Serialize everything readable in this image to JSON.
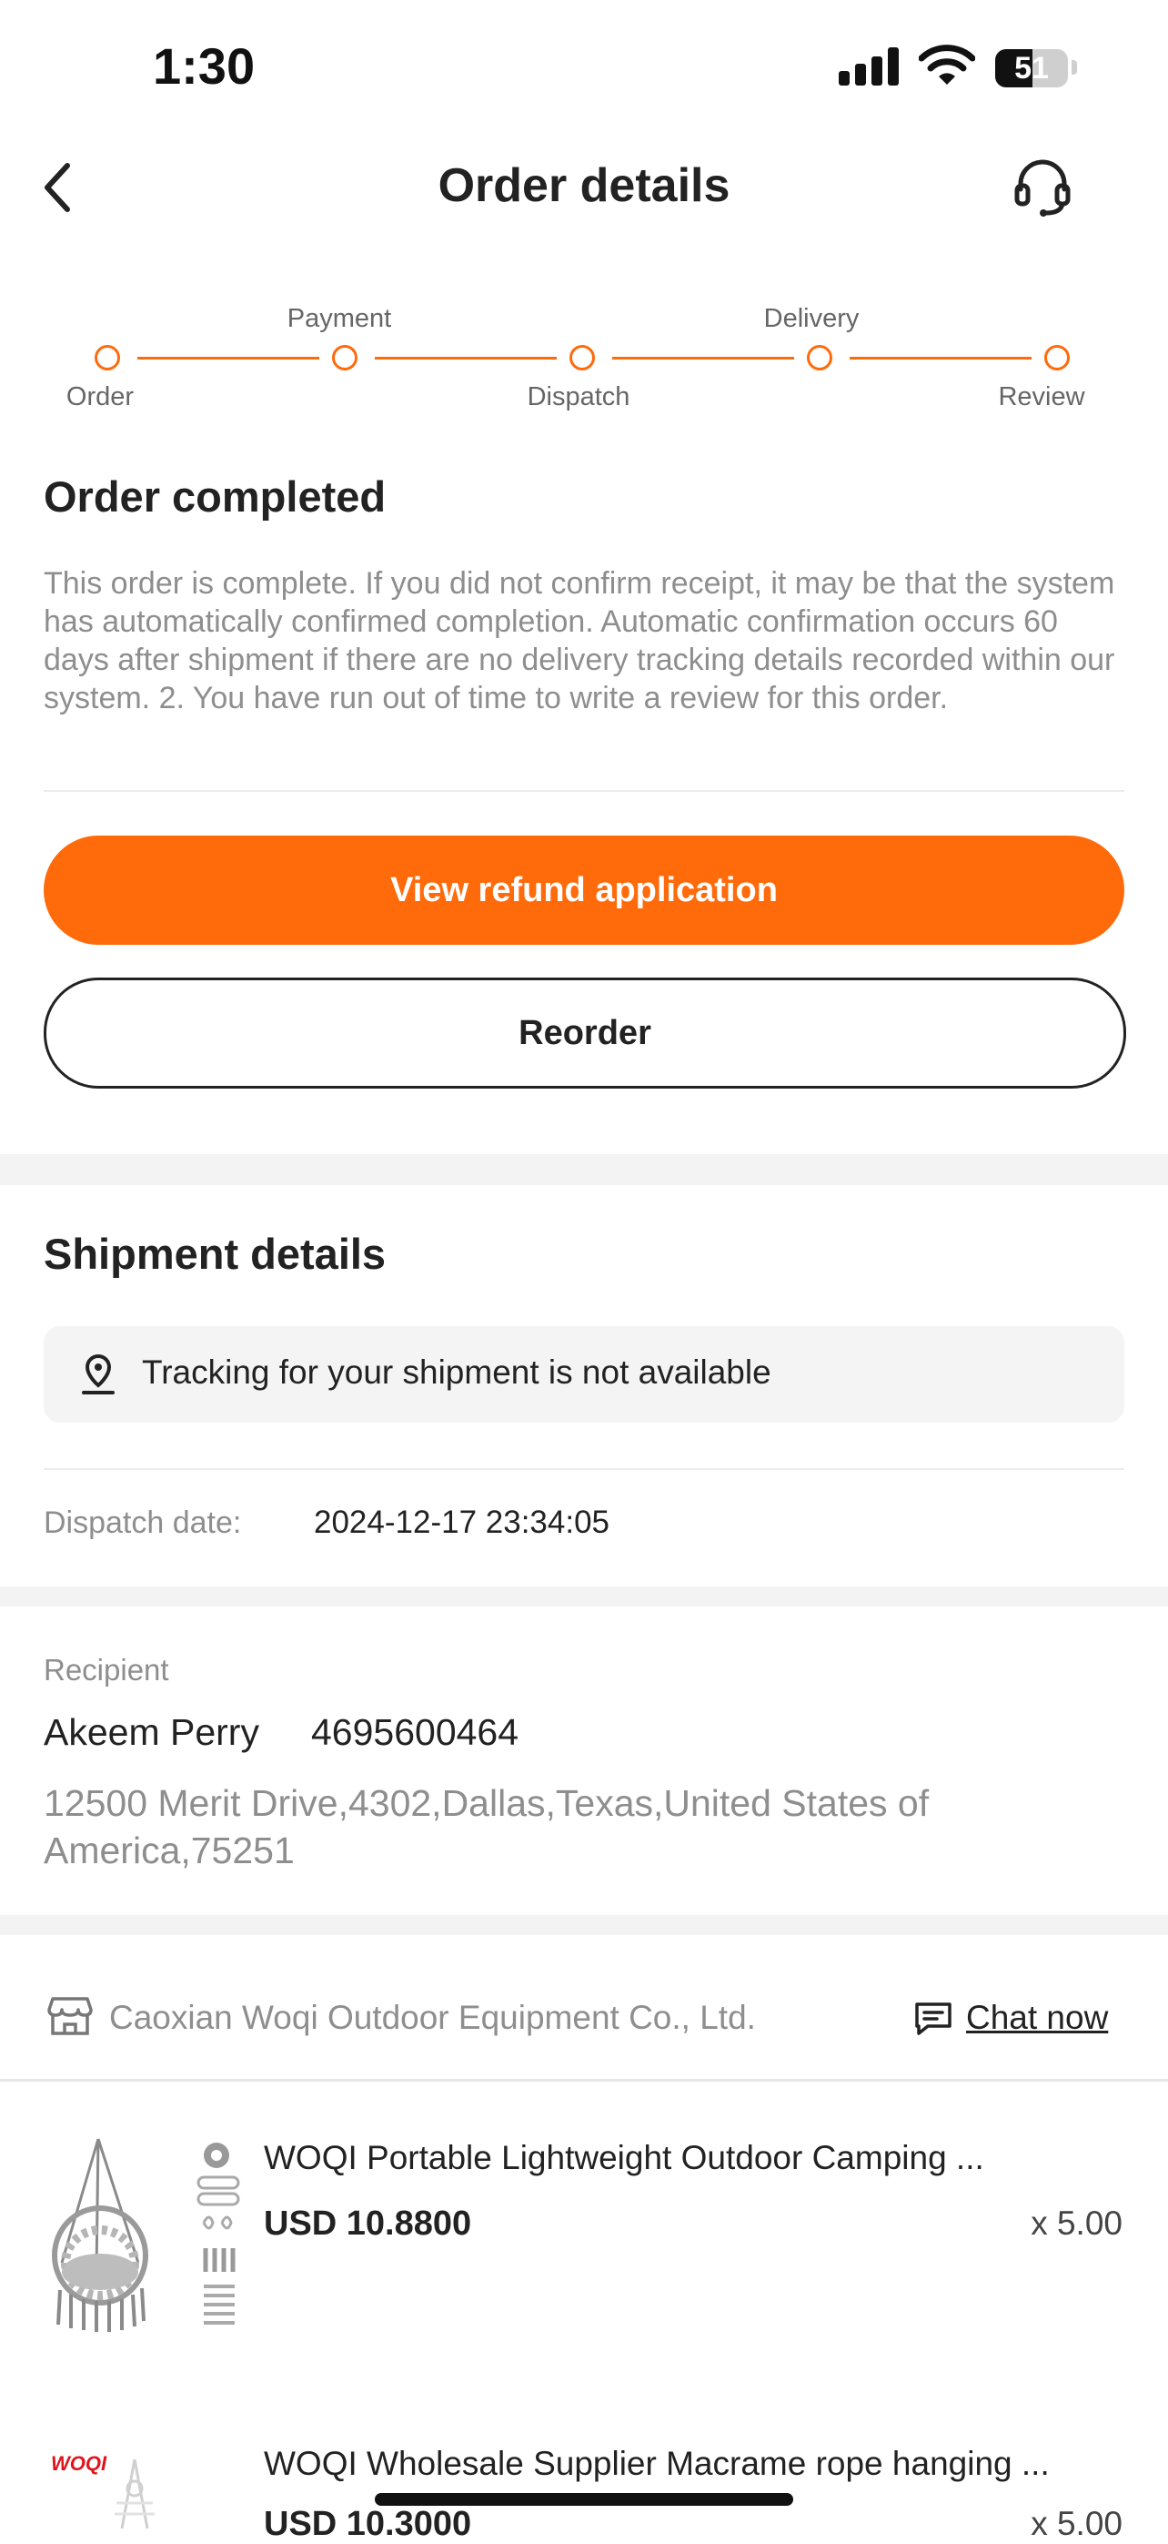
{
  "status_bar": {
    "time": "1:30",
    "battery": "51",
    "battery_fraction": 0.51
  },
  "header": {
    "title": "Order details"
  },
  "progress": {
    "steps": [
      "Order",
      "Payment",
      "Dispatch",
      "Delivery",
      "Review"
    ],
    "accent": "#ff6a0a"
  },
  "order_status": {
    "title": "Order completed",
    "description": "This order is complete. If you did not confirm receipt, it may be that the system has automatically confirmed completion. Automatic confirmation occurs 60 days after shipment if there are no delivery tracking details recorded within our system. 2. You have run out of time to write a review for this order."
  },
  "actions": {
    "primary": "View refund application",
    "secondary": "Reorder"
  },
  "shipment": {
    "title": "Shipment details",
    "tracking_text": "Tracking for your shipment is not available",
    "dispatch_label": "Dispatch date:",
    "dispatch_value": "2024-12-17 23:34:05"
  },
  "recipient": {
    "label": "Recipient",
    "name": "Akeem Perry",
    "phone": "4695600464",
    "address": "12500 Merit Drive,4302,Dallas,Texas,United States of America,75251"
  },
  "store": {
    "name": "Caoxian Woqi Outdoor Equipment Co., Ltd.",
    "chat": "Chat now"
  },
  "products": [
    {
      "title": "WOQI Portable Lightweight Outdoor Camping ...",
      "price": "USD 10.8800",
      "qty": "x 5.00"
    },
    {
      "title": "WOQI Wholesale Supplier Macrame rope hanging ...",
      "price": "USD 10.3000",
      "qty": "x 5.00",
      "brand": "WOQI"
    }
  ]
}
